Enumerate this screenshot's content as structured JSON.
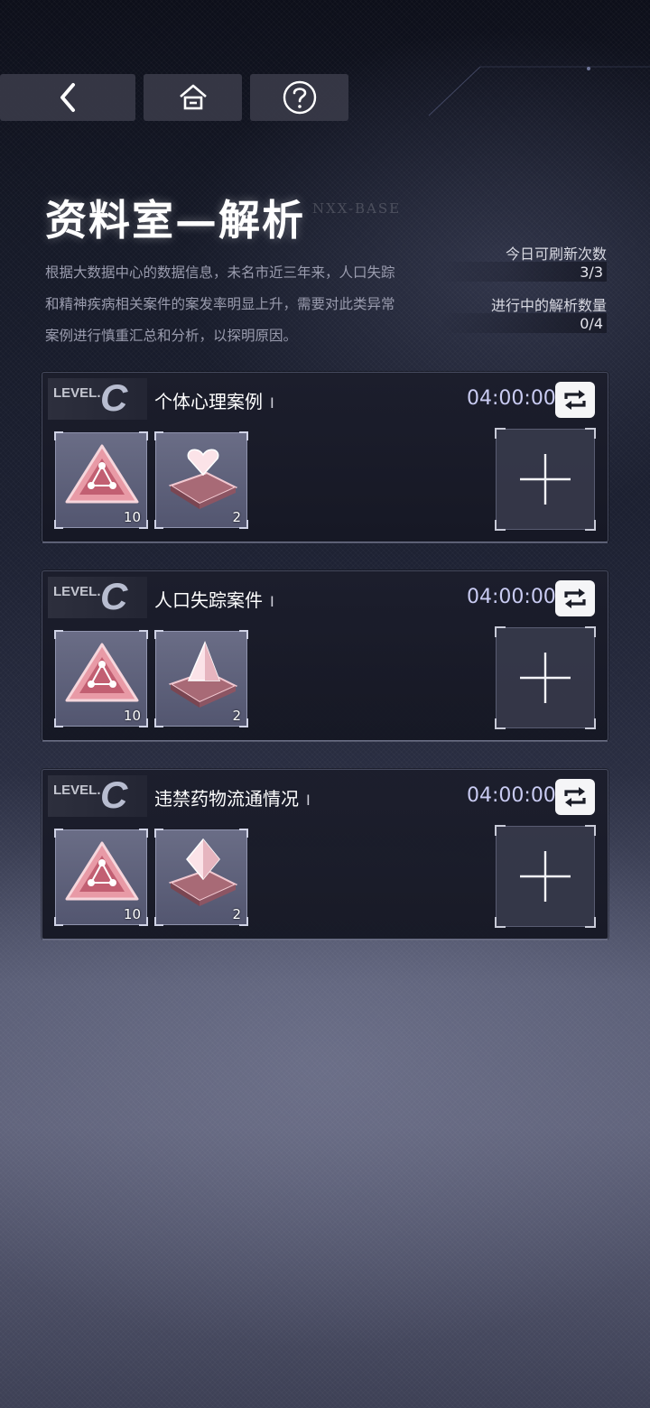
{
  "header": {
    "back_icon": "chevron-left-icon",
    "home_icon": "home-icon",
    "help_icon": "question-circle-icon"
  },
  "page": {
    "title": "资料室—解析",
    "title_tag": "NXX-BASE",
    "description": "根据大数据中心的数据信息，未名市近三年来，人口失踪和精神疾病相关案件的案发率明显上升，需要对此类异常案例进行慎重汇总和分析，以探明原因。"
  },
  "stats": {
    "refresh_label": "今日可刷新次数",
    "refresh_value": "3/3",
    "progress_label": "进行中的解析数量",
    "progress_value": "0/4"
  },
  "cases": [
    {
      "level_word": "LEVEL.",
      "level": "C",
      "name": "个体心理案例",
      "cursor": "I",
      "timer": "04:00:00",
      "items": [
        {
          "icon": "pink-triangle-badge-icon",
          "count": "10"
        },
        {
          "icon": "heart-crystal-pad-icon",
          "count": "2"
        }
      ]
    },
    {
      "level_word": "LEVEL.",
      "level": "C",
      "name": "人口失踪案件",
      "cursor": "I",
      "timer": "04:00:00",
      "items": [
        {
          "icon": "pink-triangle-badge-icon",
          "count": "10"
        },
        {
          "icon": "pyramid-crystal-pad-icon",
          "count": "2"
        }
      ]
    },
    {
      "level_word": "LEVEL.",
      "level": "C",
      "name": "违禁药物流通情况",
      "cursor": "I",
      "timer": "04:00:00",
      "items": [
        {
          "icon": "pink-triangle-badge-icon",
          "count": "10"
        },
        {
          "icon": "diamond-crystal-pad-icon",
          "count": "2"
        }
      ]
    }
  ],
  "colors": {
    "accent_timer": "#c9cbf2",
    "item_pink": "#e89aa6"
  }
}
